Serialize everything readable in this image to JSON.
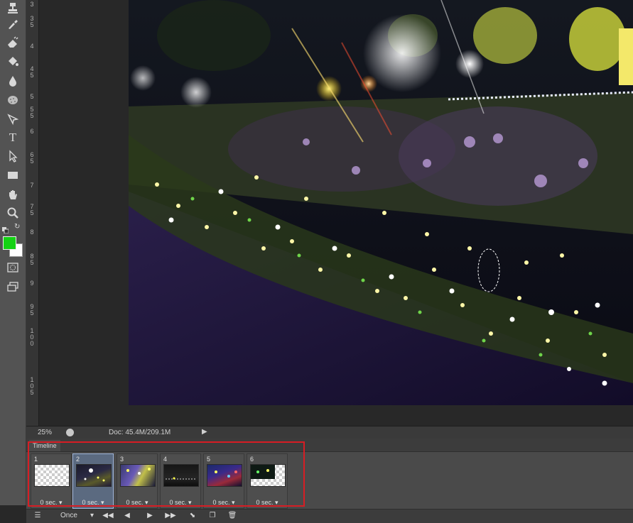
{
  "statusbar": {
    "zoom": "25%",
    "doc_info": "Doc: 45.4M/209.1M"
  },
  "ruler_labels": [
    "3",
    "3 5",
    "4",
    "4 5",
    "5",
    "5 5",
    "6",
    "6 5",
    "7",
    "7 5",
    "8",
    "8 5",
    "9",
    "9 5",
    "1 0 0",
    "1 0 5"
  ],
  "timeline": {
    "tab_label": "Timeline",
    "frames": [
      {
        "number": "1",
        "delay": "0 sec.",
        "thumb": "transparent"
      },
      {
        "number": "2",
        "delay": "0 sec.",
        "thumb": "garden-lights"
      },
      {
        "number": "3",
        "delay": "0 sec.",
        "thumb": "tree-lights"
      },
      {
        "number": "4",
        "delay": "0 sec.",
        "thumb": "dark-street"
      },
      {
        "number": "5",
        "delay": "0 sec.",
        "thumb": "colorful-lights"
      },
      {
        "number": "6",
        "delay": "0 sec.",
        "thumb": "partial-transparent"
      }
    ],
    "selected_frame": "2",
    "loop_option": "Once"
  },
  "colors": {
    "foreground": "#14d214",
    "background": "#ffffff",
    "highlight_box": "#d71d24"
  },
  "tools": [
    "stamp-icon",
    "history-brush-icon",
    "eraser-icon",
    "paint-bucket-icon",
    "blur-icon",
    "sponge-icon",
    "pen-icon",
    "type-icon",
    "path-selection-icon",
    "rectangle-icon",
    "hand-icon",
    "zoom-icon"
  ]
}
